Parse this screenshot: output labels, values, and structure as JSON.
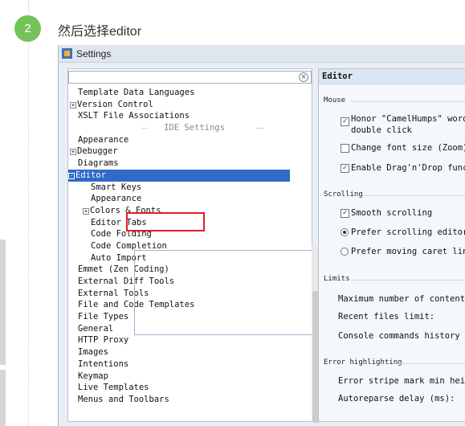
{
  "step": {
    "number": "2",
    "text": "然后选择editor"
  },
  "window": {
    "title": "Settings"
  },
  "search": {
    "placeholder": ""
  },
  "tree": [
    {
      "label": "Template Data Languages",
      "indent": 0
    },
    {
      "label": "Version Control",
      "indent": 0,
      "expander": "+"
    },
    {
      "label": "XSLT File Associations",
      "indent": 0
    },
    {
      "label": "IDE Settings",
      "indent": 0,
      "separator": true
    },
    {
      "label": "Appearance",
      "indent": 0
    },
    {
      "label": "Debugger",
      "indent": 0,
      "expander": "+"
    },
    {
      "label": "Diagrams",
      "indent": 0
    },
    {
      "label": "Editor",
      "indent": 0,
      "expander": "-",
      "selected": true
    },
    {
      "label": "Smart Keys",
      "indent": 1
    },
    {
      "label": "Appearance",
      "indent": 1
    },
    {
      "label": "Colors & Fonts",
      "indent": 1,
      "expander": "+"
    },
    {
      "label": "Editor Tabs",
      "indent": 1
    },
    {
      "label": "Code Folding",
      "indent": 1
    },
    {
      "label": "Code Completion",
      "indent": 1
    },
    {
      "label": "Auto Import",
      "indent": 1
    },
    {
      "label": "Emmet (Zen Coding)",
      "indent": 0
    },
    {
      "label": "External Diff Tools",
      "indent": 0
    },
    {
      "label": "External Tools",
      "indent": 0
    },
    {
      "label": "File and Code Templates",
      "indent": 0
    },
    {
      "label": "File Types",
      "indent": 0
    },
    {
      "label": "General",
      "indent": 0
    },
    {
      "label": "HTTP Proxy",
      "indent": 0
    },
    {
      "label": "Images",
      "indent": 0
    },
    {
      "label": "Intentions",
      "indent": 0
    },
    {
      "label": "Keymap",
      "indent": 0
    },
    {
      "label": "Live Templates",
      "indent": 0
    },
    {
      "label": "Menus and Toolbars",
      "indent": 0
    }
  ],
  "right": {
    "header": "Editor",
    "mouse_label": "Mouse",
    "honor_camel_line1": "Honor \"CamelHumps\" words",
    "honor_camel_line2": "double click",
    "change_font_size": "Change font size (Zoom)",
    "enable_drag_drop": "Enable Drag'n'Drop funct",
    "scrolling_label": "Scrolling",
    "smooth_scrolling": "Smooth scrolling",
    "prefer_scrolling_editor": "Prefer scrolling editor",
    "prefer_moving_caret": "Prefer moving caret line",
    "limits_label": "Limits",
    "max_contents": "Maximum number of contents",
    "recent_files": "Recent files limit:",
    "console_history": "Console commands history si",
    "error_label": "Error highlighting",
    "error_stripe": "Error stripe mark min heigh",
    "autoreparse": "Autoreparse delay (ms):"
  },
  "checked": {
    "honor_camel": true,
    "change_font_size": false,
    "enable_drag_drop": true,
    "smooth_scrolling": true,
    "prefer_scrolling_editor": true,
    "prefer_moving_caret": false
  },
  "colors": {
    "selection": "#2f6ac8",
    "highlight_box": "#e21b24",
    "step_badge": "#73c35a"
  }
}
